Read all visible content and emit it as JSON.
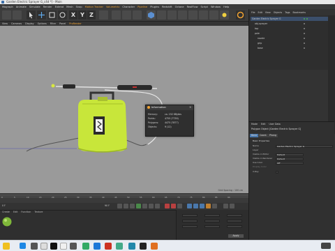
{
  "window": {
    "title": "Garden Electric Sprayer G_c4d *] - Main"
  },
  "menubar": {
    "items": [
      "Mograph",
      "Animate",
      "Simulate",
      "Render",
      "Extend",
      "Mesh",
      "Snap",
      "Motion Tracker",
      "Volumetrix",
      "Character",
      "Pipeline",
      "Plugins",
      "Redshift",
      "Octane",
      "RealFlow",
      "Script",
      "Window",
      "Help"
    ]
  },
  "viewport_menu": {
    "items": [
      "View",
      "Cameras",
      "Display",
      "Options",
      "Filter",
      "Panel",
      "ProRender"
    ]
  },
  "viewport": {
    "grid_spacing": "Grid Spacing : 100 cm"
  },
  "info_dialog": {
    "title": "Information",
    "rows": [
      {
        "label": "Memory:",
        "value": "ca. 152 KBytes"
      },
      {
        "label": "Points:",
        "value": "4755 (7739)"
      },
      {
        "label": "Polygons:",
        "value": "4475 (7877)"
      },
      {
        "label": "Objects:",
        "value": "9 (12)"
      }
    ]
  },
  "object_manager": {
    "menu": [
      "File",
      "Edit",
      "View",
      "Objects",
      "Tags",
      "Bookmarks"
    ],
    "rows": [
      {
        "label": "Garden Electric Sprayer G",
        "selected": true
      },
      {
        "label": "obj-sprayer",
        "selected": false
      },
      {
        "label": "top",
        "selected": false
      },
      {
        "label": "pole",
        "selected": false
      },
      {
        "label": "nozzle",
        "selected": false
      },
      {
        "label": "grip",
        "selected": false
      },
      {
        "label": "base",
        "selected": false
      }
    ]
  },
  "attribute_manager": {
    "menu": [
      "Mode",
      "Edit",
      "User Data"
    ],
    "title": "Polygon Object [Garden Electric Sprayer G]",
    "tabs": [
      "Basic",
      "Coord.",
      "Phong"
    ],
    "section": "Basic Properties",
    "rows": [
      {
        "label": "Name",
        "value": "Garden Electric Sprayer G"
      },
      {
        "label": "Layer",
        "value": ""
      },
      {
        "label": "Visible in Editor",
        "value": "Default"
      },
      {
        "label": "Visible in Renderer",
        "value": "Default"
      },
      {
        "label": "Use Color",
        "value": "Off"
      },
      {
        "label": "Display Color",
        "value": ""
      },
      {
        "label": "X-Ray",
        "value": ""
      }
    ]
  },
  "materials": {
    "menu": [
      "Create",
      "Edit",
      "Function",
      "Texture"
    ]
  },
  "coordinates": {
    "apply_label": "Apply"
  },
  "timeline": {
    "ticks": [
      "0",
      "5",
      "10",
      "15",
      "20",
      "25",
      "30",
      "35",
      "40",
      "45",
      "50",
      "55",
      "60",
      "65",
      "70",
      "75",
      "80",
      "85",
      "90"
    ],
    "frame": "0 F",
    "end": "90 F"
  },
  "colors": {
    "accent": "#f0a232",
    "selection": "#4a78ac",
    "sprayer": "#c8e63a"
  }
}
